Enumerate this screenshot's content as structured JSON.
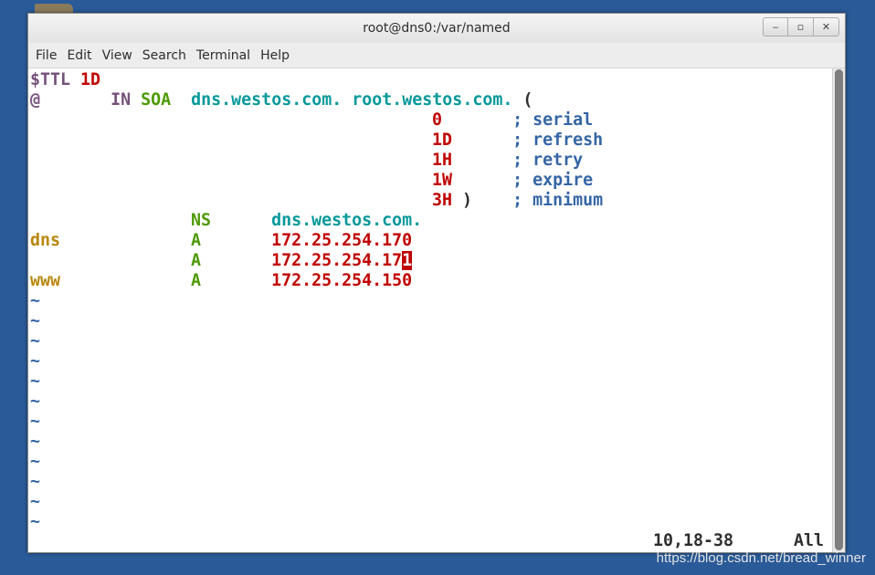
{
  "window": {
    "title": "root@dns0:/var/named",
    "buttons": {
      "minimize": "‒",
      "maximize": "▫",
      "close": "✕"
    }
  },
  "menu": [
    "File",
    "Edit",
    "View",
    "Search",
    "Terminal",
    "Help"
  ],
  "file": {
    "line1": {
      "directive": "$TTL",
      "value": "1D"
    },
    "line2": {
      "origin": "@",
      "gap": "       ",
      "class": "IN",
      "type": "SOA",
      "primary_ns": "dns.westos.com.",
      "admin": "root.westos.com.",
      "paren": "("
    },
    "soa": [
      {
        "value": "0",
        "comment": "; serial"
      },
      {
        "value": "1D",
        "comment": "; refresh"
      },
      {
        "value": "1H",
        "comment": "; retry"
      },
      {
        "value": "1W",
        "comment": "; expire"
      },
      {
        "value": "3H",
        "close": ")",
        "comment": "; minimum"
      }
    ],
    "records": [
      {
        "name": "",
        "type": "NS",
        "data": "dns.westos.com."
      },
      {
        "name": "dns",
        "type": "A",
        "data": "172.25.254.170"
      },
      {
        "name": "",
        "type": "A",
        "data_before": "172.25.254.17",
        "data_cursor": "1"
      },
      {
        "name": "www",
        "type": "A",
        "data": "172.25.254.150"
      }
    ],
    "tilde": "~"
  },
  "status": {
    "position": "10,18-38",
    "scroll": "All"
  },
  "watermark": "https://blog.csdn.net/bread_winner",
  "colors": {
    "desktop": "#2a5a98",
    "number": "#c00000",
    "keyword": "#4e9a06",
    "identifier": "#06989a",
    "comment": "#3465a4",
    "origin": "#75507b",
    "hostname": "#b8860b"
  }
}
